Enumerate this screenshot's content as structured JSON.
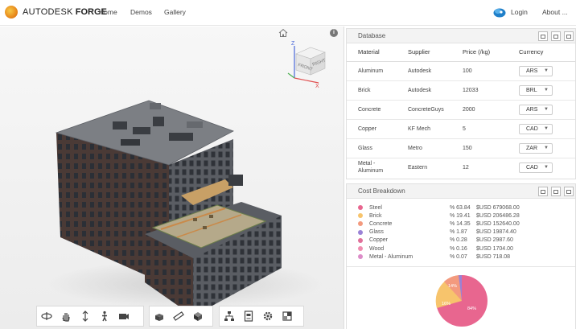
{
  "header": {
    "logo_text_a": "AUTODESK",
    "logo_text_b": "FORGE",
    "nav": [
      "Home",
      "Demos",
      "Gallery"
    ],
    "login": "Login",
    "about": "About ..."
  },
  "viewcube": {
    "front": "FRONT",
    "right": "RIGHT",
    "axis_z": "Z",
    "axis_x": "X"
  },
  "database": {
    "title": "Database",
    "columns": [
      "Material",
      "Supplier",
      "Price (/kg)",
      "Currency"
    ],
    "rows": [
      {
        "material": "Aluminum",
        "supplier": "Autodesk",
        "price": "100",
        "currency": "ARS"
      },
      {
        "material": "Brick",
        "supplier": "Autodesk",
        "price": "12033",
        "currency": "BRL"
      },
      {
        "material": "Concrete",
        "supplier": "ConcreteGuys",
        "price": "2000",
        "currency": "ARS"
      },
      {
        "material": "Copper",
        "supplier": "KF Mech",
        "price": "5",
        "currency": "CAD"
      },
      {
        "material": "Glass",
        "supplier": "Metro",
        "price": "150",
        "currency": "ZAR"
      },
      {
        "material": "Metal - Aluminum",
        "supplier": "Eastern",
        "price": "12",
        "currency": "CAD"
      }
    ]
  },
  "cost": {
    "title": "Cost Breakdown",
    "items": [
      {
        "name": "Steel",
        "pct": "% 63.84",
        "value": "$USD 679068.00",
        "color": "#e8668f"
      },
      {
        "name": "Brick",
        "pct": "% 19.41",
        "value": "$USD 206486.28",
        "color": "#f7c46c"
      },
      {
        "name": "Concrete",
        "pct": "% 14.35",
        "value": "$USD 152640.00",
        "color": "#f39a7e"
      },
      {
        "name": "Glass",
        "pct": "% 1.87",
        "value": "$USD 19874.40",
        "color": "#9a82d6"
      },
      {
        "name": "Copper",
        "pct": "% 0.28",
        "value": "$USD 2987.60",
        "color": "#e0709a"
      },
      {
        "name": "Wood",
        "pct": "% 0.16",
        "value": "$USD 1704.00",
        "color": "#f08db0"
      },
      {
        "name": "Metal - Aluminum",
        "pct": "% 0.07",
        "value": "$USD 718.08",
        "color": "#dc8cc8"
      }
    ],
    "pie_labels": [
      "84%",
      "16%",
      "14%"
    ]
  }
}
